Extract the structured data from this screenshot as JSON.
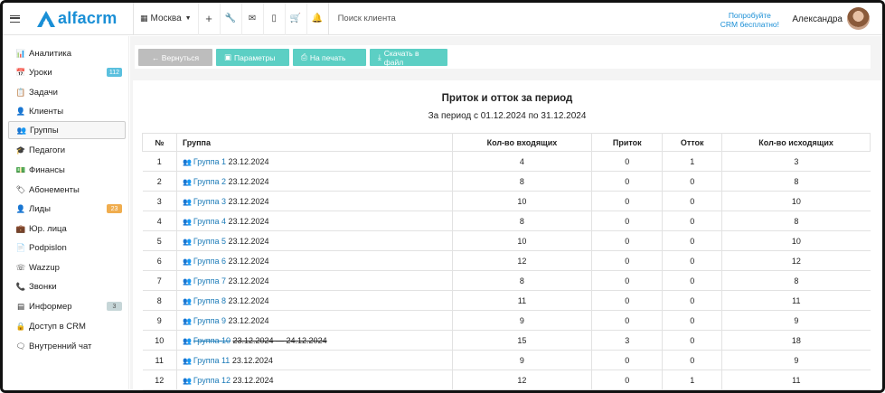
{
  "header": {
    "logo_text": "alfacrm",
    "city": "Москва",
    "search_placeholder": "Поиск клиента",
    "promo_line1": "Попробуйте",
    "promo_line2": "CRM бесплатно!",
    "user_name": "Александра"
  },
  "sidebar": {
    "items": [
      {
        "label": "Аналитика",
        "icon": "chart-icon"
      },
      {
        "label": "Уроки",
        "icon": "calendar-icon",
        "badge": "112"
      },
      {
        "label": "Задачи",
        "icon": "tasks-icon"
      },
      {
        "label": "Клиенты",
        "icon": "user-icon"
      },
      {
        "label": "Группы",
        "icon": "users-icon"
      },
      {
        "label": "Педагоги",
        "icon": "graduation-cap-icon"
      },
      {
        "label": "Финансы",
        "icon": "money-icon"
      },
      {
        "label": "Абонементы",
        "icon": "tag-icon"
      },
      {
        "label": "Лиды",
        "icon": "user-plus-icon",
        "badge": "23"
      },
      {
        "label": "Юр. лица",
        "icon": "briefcase-icon"
      },
      {
        "label": "Podpislon",
        "icon": "file-icon"
      },
      {
        "label": "Wazzup",
        "icon": "whatsapp-icon"
      },
      {
        "label": "Звонки",
        "icon": "phone-icon"
      },
      {
        "label": "Информер",
        "icon": "informer-icon",
        "badge": "3"
      },
      {
        "label": "Доступ в CRM",
        "icon": "lock-icon"
      },
      {
        "label": "Внутренний чат",
        "icon": "chat-icon"
      }
    ]
  },
  "toolbar": {
    "back_label": "← Вернуться",
    "params_label": "Параметры",
    "print_label": "На печать",
    "download_label": "Скачать в файл"
  },
  "report": {
    "title": "Приток и отток за период",
    "subtitle": "За период с 01.12.2024 по 31.12.2024",
    "columns": [
      "№",
      "Группа",
      "Кол-во входящих",
      "Приток",
      "Отток",
      "Кол-во исходящих"
    ],
    "rows": [
      {
        "n": "1",
        "group": "Группа 1",
        "date": "23.12.2024",
        "incoming": "4",
        "inflow": "0",
        "outflow": "1",
        "outgoing": "3"
      },
      {
        "n": "2",
        "group": "Группа 2",
        "date": "23.12.2024",
        "incoming": "8",
        "inflow": "0",
        "outflow": "0",
        "outgoing": "8"
      },
      {
        "n": "3",
        "group": "Группа 3",
        "date": "23.12.2024",
        "incoming": "10",
        "inflow": "0",
        "outflow": "0",
        "outgoing": "10"
      },
      {
        "n": "4",
        "group": "Группа 4",
        "date": "23.12.2024",
        "incoming": "8",
        "inflow": "0",
        "outflow": "0",
        "outgoing": "8"
      },
      {
        "n": "5",
        "group": "Группа 5",
        "date": "23.12.2024",
        "incoming": "10",
        "inflow": "0",
        "outflow": "0",
        "outgoing": "10"
      },
      {
        "n": "6",
        "group": "Группа 6",
        "date": "23.12.2024",
        "incoming": "12",
        "inflow": "0",
        "outflow": "0",
        "outgoing": "12"
      },
      {
        "n": "7",
        "group": "Группа 7",
        "date": "23.12.2024",
        "incoming": "8",
        "inflow": "0",
        "outflow": "0",
        "outgoing": "8"
      },
      {
        "n": "8",
        "group": "Группа 8",
        "date": "23.12.2024",
        "incoming": "11",
        "inflow": "0",
        "outflow": "0",
        "outgoing": "11"
      },
      {
        "n": "9",
        "group": "Группа 9",
        "date": "23.12.2024",
        "incoming": "9",
        "inflow": "0",
        "outflow": "0",
        "outgoing": "9"
      },
      {
        "n": "10",
        "group": "Группа 10",
        "date": "23.12.2024 — 24.12.2024",
        "incoming": "15",
        "inflow": "3",
        "outflow": "0",
        "outgoing": "18",
        "archived": true
      },
      {
        "n": "11",
        "group": "Группа 11",
        "date": "23.12.2024",
        "incoming": "9",
        "inflow": "0",
        "outflow": "0",
        "outgoing": "9"
      },
      {
        "n": "12",
        "group": "Группа 12",
        "date": "23.12.2024",
        "incoming": "12",
        "inflow": "0",
        "outflow": "1",
        "outgoing": "11"
      }
    ]
  }
}
